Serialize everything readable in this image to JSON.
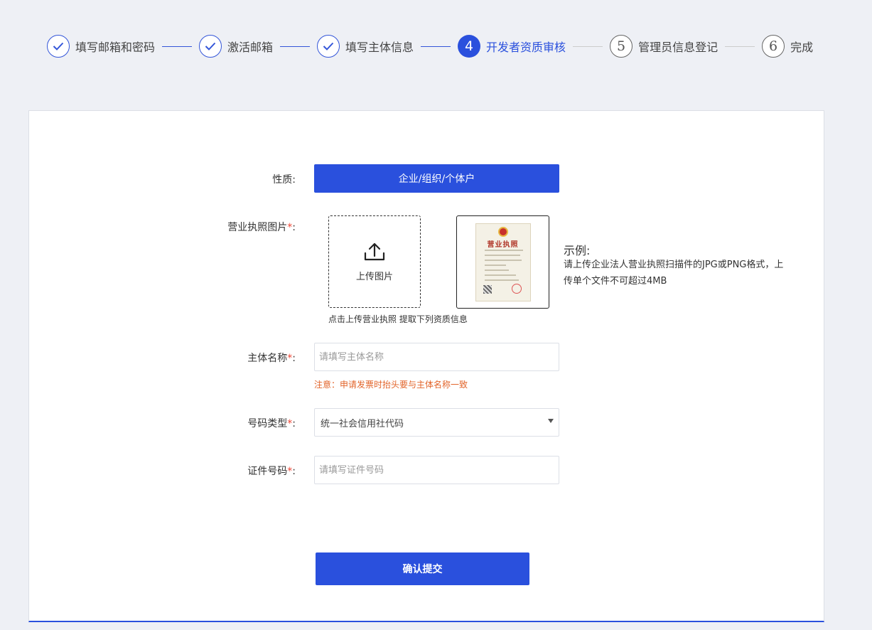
{
  "stepper": {
    "steps": [
      {
        "label": "填写邮箱和密码",
        "state": "done"
      },
      {
        "label": "激活邮箱",
        "state": "done"
      },
      {
        "label": "填写主体信息",
        "state": "done"
      },
      {
        "label": "开发者资质审核",
        "state": "active",
        "number": "4"
      },
      {
        "label": "管理员信息登记",
        "state": "todo",
        "number": "5"
      },
      {
        "label": "完成",
        "state": "todo",
        "number": "6"
      }
    ]
  },
  "form": {
    "nature": {
      "label": "性质:",
      "value": "企业/组织/个体户"
    },
    "license": {
      "label": "营业执照图片",
      "required_mark": "*",
      "colon": ":",
      "upload_text": "上传图片",
      "upload_hint": "点击上传营业执照 提取下列资质信息",
      "sample_cert_title": "营业执照",
      "sample_title": "示例:",
      "sample_desc": "请上传企业法人营业执照扫描件的JPG或PNG格式，上传单个文件不可超过4MB"
    },
    "entity_name": {
      "label": "主体名称",
      "required_mark": "*",
      "colon": ":",
      "placeholder": "请填写主体名称",
      "note": "注意：申请发票时抬头要与主体名称一致"
    },
    "id_type": {
      "label": "号码类型",
      "required_mark": "*",
      "colon": ":",
      "selected": "统一社会信用社代码"
    },
    "id_number": {
      "label": "证件号码",
      "required_mark": "*",
      "colon": ":",
      "placeholder": "请填写证件号码"
    },
    "submit_label": "确认提交"
  },
  "colors": {
    "accent": "#2a50dd",
    "required": "#e43",
    "note": "#e2642a",
    "background": "#eef0f5"
  }
}
